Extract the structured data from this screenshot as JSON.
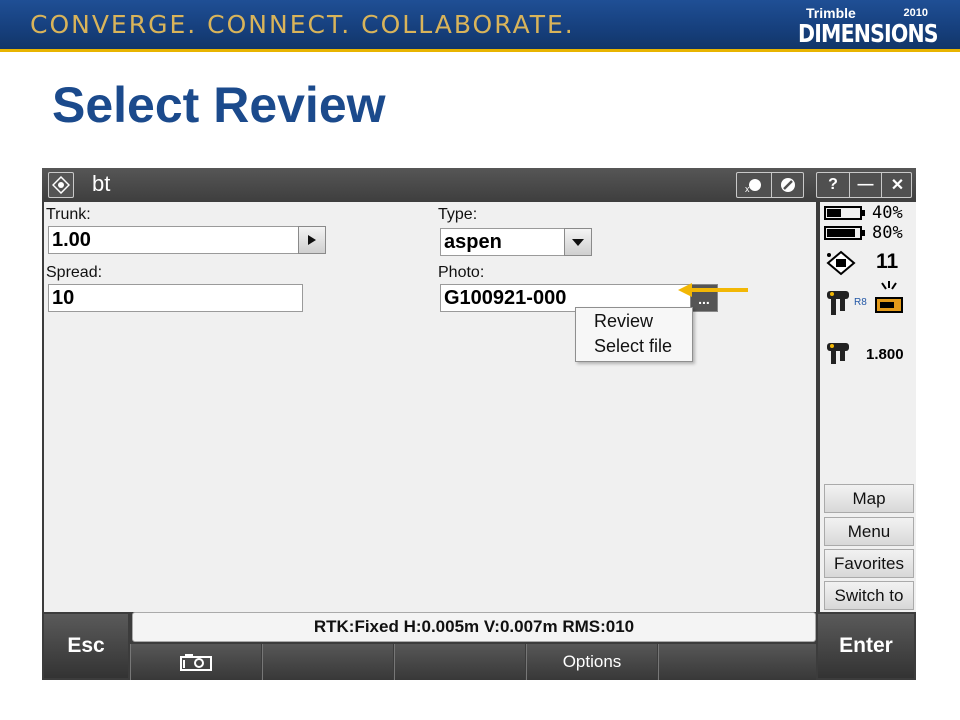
{
  "banner": {
    "tagline": "CONVERGE. CONNECT. COLLABORATE.",
    "logo_trimble": "Trimble",
    "logo_year": "2010",
    "logo_dimensions": "DIMENSIONS"
  },
  "slide_title": "Select Review",
  "window": {
    "title": "bt",
    "app_icon": "trimble-access-icon",
    "help_label": "?",
    "minimize_label": "—",
    "close_label": "✕"
  },
  "form": {
    "trunk": {
      "label": "Trunk:",
      "value": "1.00"
    },
    "spread": {
      "label": "Spread:",
      "value": "10"
    },
    "type": {
      "label": "Type:",
      "value": "aspen"
    },
    "photo": {
      "label": "Photo:",
      "value": "G100921-000",
      "button": "..."
    }
  },
  "context_menu": {
    "items": [
      {
        "label": "Review"
      },
      {
        "label": "Select file"
      }
    ]
  },
  "status_panel": {
    "battery1": "40%",
    "battery2": "80%",
    "satellites": "11",
    "antenna_height": "1.800",
    "rover_label": "R8"
  },
  "side_buttons": [
    "Map",
    "Menu",
    "Favorites",
    "Switch to"
  ],
  "status_bar": "RTK:Fixed H:0.005m V:0.007m RMS:010",
  "bottom": {
    "esc": "Esc",
    "enter": "Enter",
    "options": "Options"
  },
  "colors": {
    "accent_arrow": "#f2b705",
    "title_blue": "#1b4a8c",
    "banner_blue": "#1f4f95"
  }
}
